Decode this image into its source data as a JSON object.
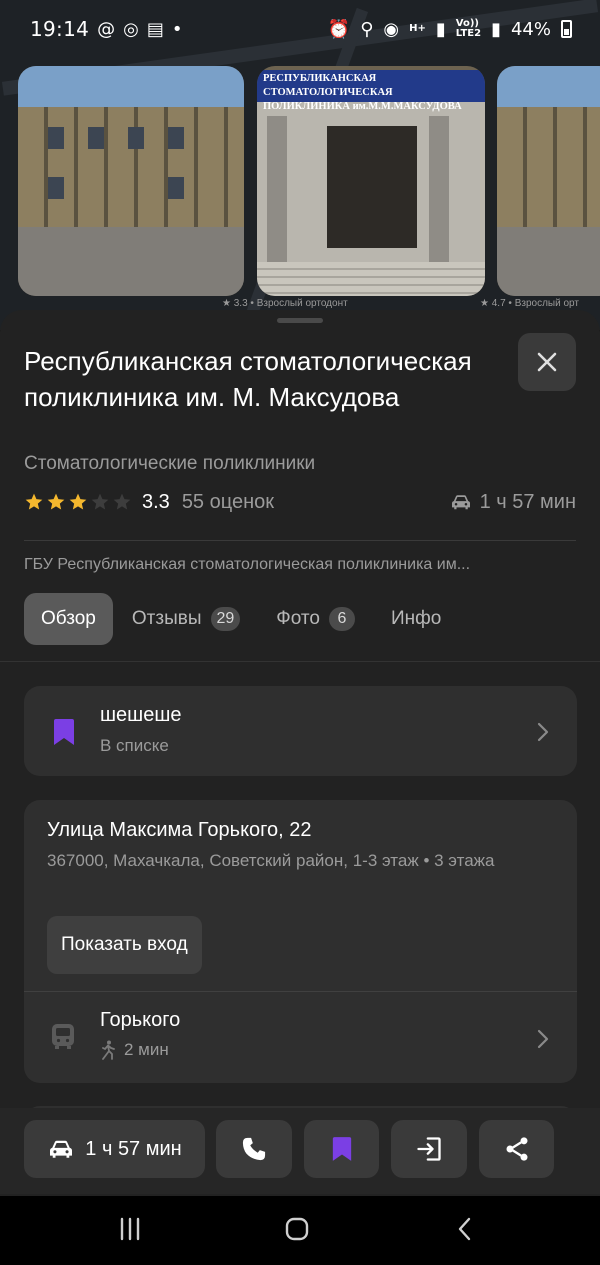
{
  "status_bar": {
    "time": "19:14",
    "network_label": "H+",
    "volte_label": "Vo))",
    "lte_label": "LTE2",
    "battery": "44%"
  },
  "photos": {
    "sign_text": "РЕСПУБЛИКАНСКАЯ СТОМАТОЛОГИЧЕСКАЯ ПОЛИКЛИНИКА им.М.М.МАКСУДОВА",
    "caption_1": "★ 3.3 • Взрослый ортодонт",
    "caption_2": "★ 4.7 • Взрослый орт"
  },
  "place": {
    "title": "Республиканская стоматологическая поликлиника им. М. Максудова",
    "category": "Стоматологические поликлиники",
    "rating": "3.3",
    "rating_stars": 3,
    "rating_count": "55 оценок",
    "drive_time": "1 ч 57 мин",
    "org_name": "ГБУ Республиканская стоматологическая поликлиника им..."
  },
  "tabs": [
    {
      "label": "Обзор",
      "badge": null,
      "active": true
    },
    {
      "label": "Отзывы",
      "badge": "29",
      "active": false
    },
    {
      "label": "Фото",
      "badge": "6",
      "active": false
    },
    {
      "label": "Инфо",
      "badge": null,
      "active": false
    }
  ],
  "list_card": {
    "title": "шешеше",
    "subtitle": "В списке"
  },
  "address_card": {
    "street": "Улица Максима Горького, 22",
    "details": "367000, Махачкала, Советский район, 1-3 этаж • 3 этажа",
    "entrance_button": "Показать вход",
    "stop_name": "Горького",
    "stop_walk": "2 мин"
  },
  "action_bar": {
    "route_time": "1 ч 57 мин"
  },
  "colors": {
    "accent_purple": "#7b3fe4",
    "star_gold": "#f5b82e",
    "sheet_bg": "#222222",
    "card_bg": "#2f2f2f"
  },
  "icons": [
    "close-icon",
    "car-icon",
    "bookmark-icon",
    "chevron-right-icon",
    "bus-icon",
    "walk-icon",
    "phone-icon",
    "enter-icon",
    "share-icon"
  ]
}
